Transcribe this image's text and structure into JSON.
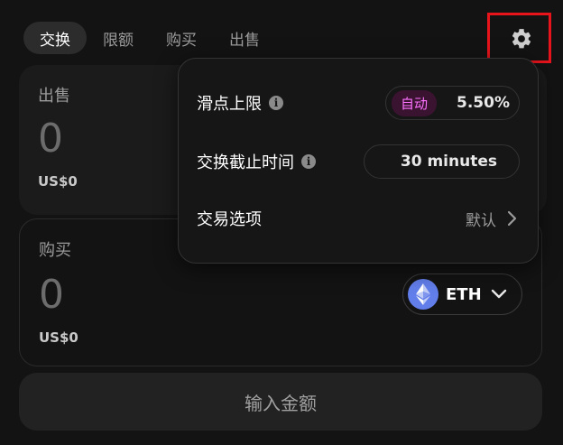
{
  "tabs": [
    "交换",
    "限额",
    "购买",
    "出售"
  ],
  "sell": {
    "label": "出售",
    "amount": "0",
    "usd": "US$0"
  },
  "buy": {
    "label": "购买",
    "amount": "0",
    "usd": "US$0",
    "token": "ETH",
    "token_icon": "ethereum-icon"
  },
  "cta": {
    "label": "输入金额"
  },
  "settings": {
    "slippage": {
      "label": "滑点上限",
      "auto": "自动",
      "value": "5.50%"
    },
    "deadline": {
      "label": "交换截止时间",
      "value": "30 minutes"
    },
    "options": {
      "label": "交易选项",
      "value": "默认"
    }
  },
  "colors": {
    "accent_pink": "#fc72ff",
    "highlight_red": "#e8141c",
    "eth_blue": "#627eea"
  }
}
